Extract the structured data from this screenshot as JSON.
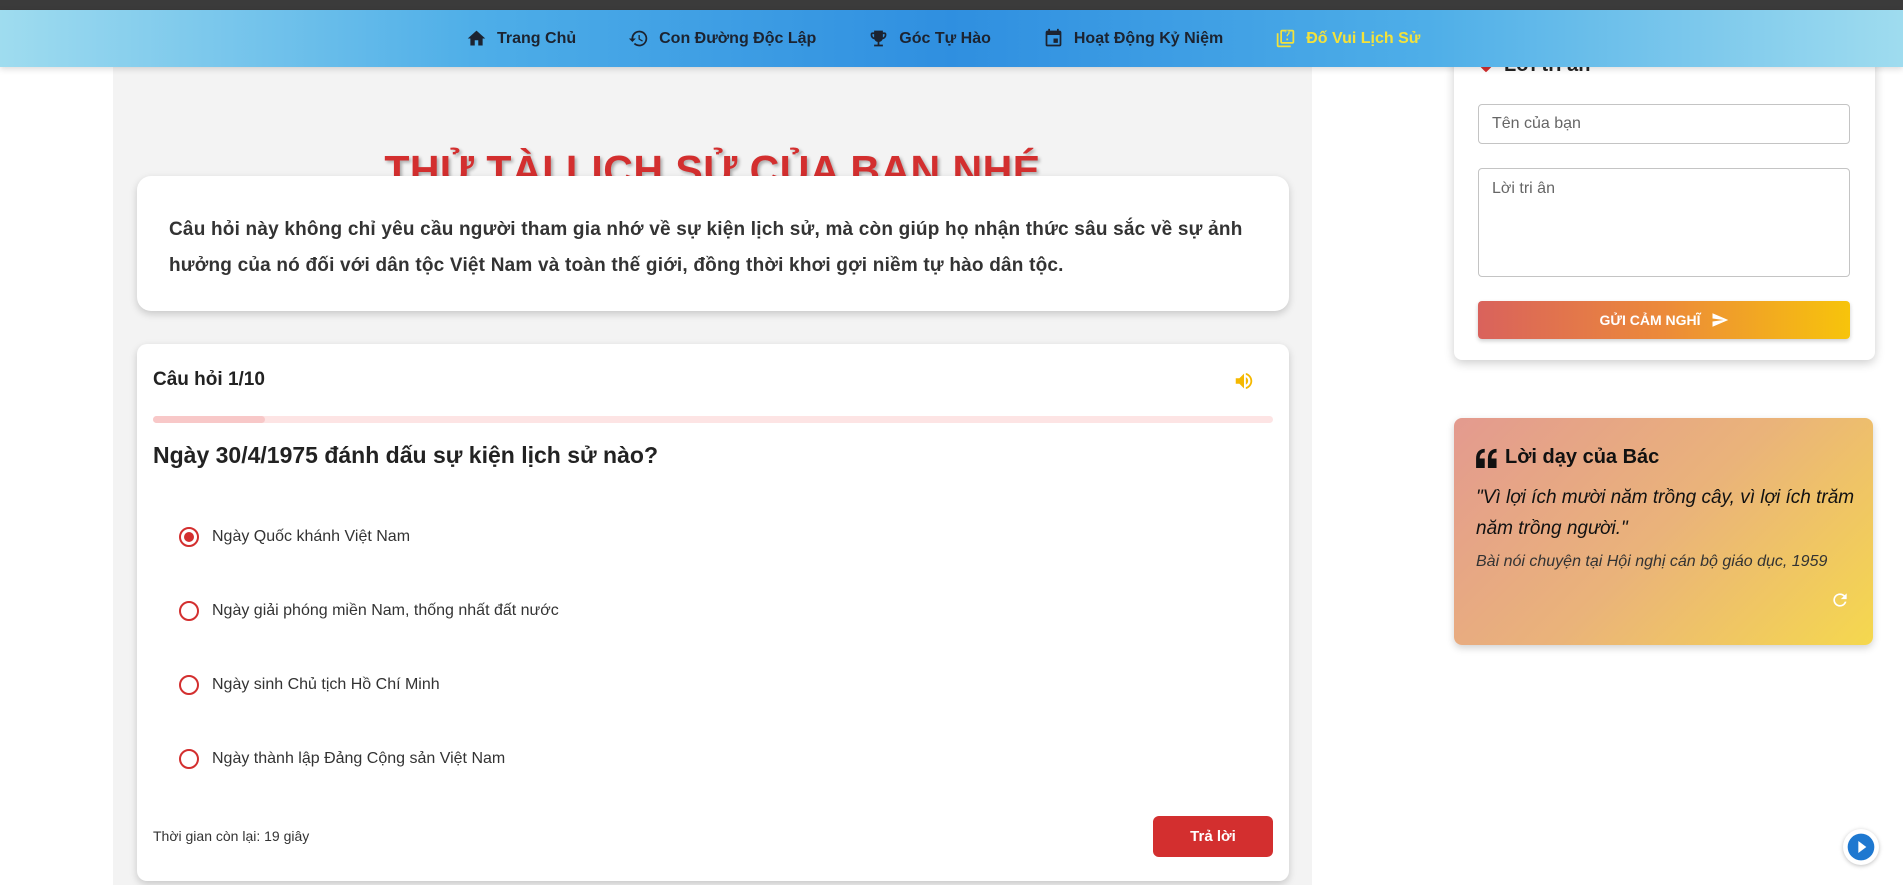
{
  "nav": {
    "items": [
      {
        "label": "Trang Chủ",
        "icon": "home-icon"
      },
      {
        "label": "Con Đường Độc Lập",
        "icon": "history-icon"
      },
      {
        "label": "Góc Tự Hào",
        "icon": "trophy-icon"
      },
      {
        "label": "Hoạt Động Kỷ Niệm",
        "icon": "calendar-icon"
      },
      {
        "label": "Đố Vui Lịch Sử",
        "icon": "quiz-icon",
        "active": true
      }
    ]
  },
  "main": {
    "title": "THỬ TÀI LỊCH SỬ CỦA BẠN NHÉ",
    "intro": "Câu hỏi này không chỉ yêu cầu người tham gia nhớ về sự kiện lịch sử, mà còn giúp họ nhận thức sâu sắc về sự ảnh hưởng của nó đối với dân tộc Việt Nam và toàn thế giới, đồng thời khơi gợi niềm tự hào dân tộc."
  },
  "quiz": {
    "counter": "Câu hỏi 1/10",
    "progress": 0.1,
    "question": "Ngày 30/4/1975 đánh dấu sự kiện lịch sử nào?",
    "options": [
      {
        "label": "Ngày Quốc khánh Việt Nam",
        "selected": true
      },
      {
        "label": "Ngày giải phóng miền Nam, thống nhất đất nước",
        "selected": false
      },
      {
        "label": "Ngày sinh Chủ tịch Hồ Chí Minh",
        "selected": false
      },
      {
        "label": "Ngày thành lập Đảng Cộng sản Việt Nam",
        "selected": false
      }
    ],
    "timer": "Thời gian còn lại: 19 giây",
    "answer_label": "Trả lời"
  },
  "gratitude": {
    "title": "Lời tri ân",
    "name_placeholder": "Tên của bạn",
    "message_placeholder": "Lời tri ân",
    "send_label": "GỬI CẢM NGHĨ"
  },
  "quote": {
    "title": "Lời dạy của Bác",
    "text": "\"Vì lợi ích mười năm trồng cây, vì lợi ích trăm năm trồng người.\"",
    "source": "Bài nói chuyện tại Hội nghị cán bộ giáo dục, 1959"
  },
  "colors": {
    "accent_red": "#d32f2f",
    "nav_active": "#f4e23a",
    "sound_icon": "#f5b800"
  }
}
